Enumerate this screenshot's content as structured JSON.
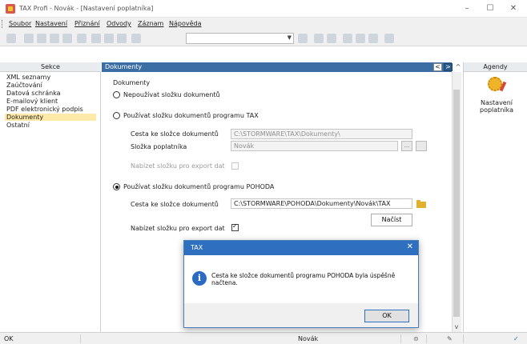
{
  "window": {
    "title": "TAX Profi - Novák - [Nastavení poplatníka]",
    "minimize_glyph": "–",
    "maximize_glyph": "☐",
    "close_glyph": "✕"
  },
  "menu": {
    "items": [
      "Soubor",
      "Nastavení",
      "Přiznání",
      "Odvody",
      "Záznam",
      "Nápověda"
    ]
  },
  "sekce": {
    "header": "Sekce",
    "items": [
      "XML seznamy",
      "Zaúčtování",
      "Datová schránka",
      "E-mailový klient",
      "PDF elektronický podpis",
      "Dokumenty",
      "Ostatní"
    ],
    "selected": "Dokumenty"
  },
  "main": {
    "header": "Dokumenty",
    "nav_prev": "<",
    "nav_next": ">",
    "section_title": "Dokumenty",
    "option_none": "Nepoužívat složku dokumentů",
    "option_tax": "Používat složku dokumentů programu TAX",
    "tax_path_label": "Cesta ke složce dokumentů",
    "tax_path_value": "C:\\STORMWARE\\TAX\\Dokumenty\\",
    "tax_folder_label": "Složka poplatníka",
    "tax_folder_value": "Novák",
    "tax_browse": "...",
    "tax_export_label": "Nabízet složku pro export dat",
    "option_pohoda": "Používat složku dokumentů programu POHODA",
    "pohoda_path_label": "Cesta ke složce dokumentů",
    "pohoda_path_value": "C:\\STORMWARE\\POHODA\\Dokumenty\\Novák\\TAX",
    "load_button": "Načíst",
    "pohoda_export_label": "Nabízet složku pro export dat",
    "selected_option": "pohoda"
  },
  "agendy": {
    "header": "Agendy",
    "item_label_line1": "Nastavení",
    "item_label_line2": "poplatníka",
    "icon": "gear-pencil-icon"
  },
  "statusbar": {
    "left": "OK",
    "center": "Novák"
  },
  "dialog": {
    "title": "TAX",
    "close_glyph": "✕",
    "message": "Cesta ke složce dokumentů programu POHODA byla úspěšně načtena.",
    "ok_label": "OK",
    "icon": "info-icon"
  },
  "colors": {
    "header_blue": "#3a6ea5",
    "dialog_blue": "#2f6fbf",
    "selected_item": "#ffe9a8"
  }
}
